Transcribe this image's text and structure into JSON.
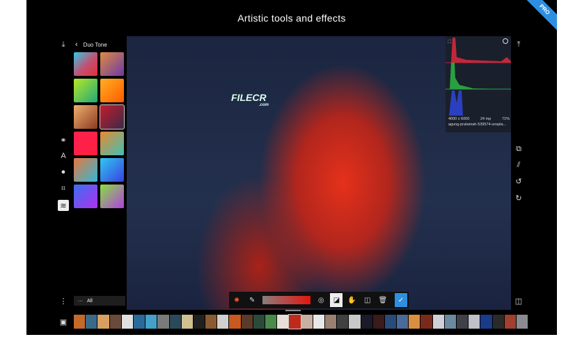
{
  "title": "Artistic tools and effects",
  "badge": "PRO",
  "panel": {
    "back_icon": "chevron-left",
    "title": "Duo Tone",
    "presets": [
      "linear-gradient(135deg,#33c7e8,#c35070 55%,#e0303a)",
      "linear-gradient(135deg,#e08a40,#6a3aa8)",
      "linear-gradient(135deg,#b8e828,#20a878)",
      "linear-gradient(135deg,#ffb020,#ff5a00)",
      "linear-gradient(135deg,#f0b070,#8a3a20)",
      "linear-gradient(135deg,#c41c2c,#3a2a48)",
      "linear-gradient(135deg,#ff2050,#ff2040)",
      "linear-gradient(135deg,#e88a30,#40c0b8)",
      "linear-gradient(135deg,#e87840,#30b8d8)",
      "linear-gradient(135deg,#30c8f0,#3a40e0)",
      "linear-gradient(135deg,#3a70f0,#b030f0)",
      "linear-gradient(135deg,#88e040,#b040e0)"
    ]
  },
  "filter_label": "All",
  "watermark": {
    "text": "FILECR",
    "sub": ".com"
  },
  "histogram": {
    "dimensions": "4000 x 6000",
    "megapixels": "24 mp",
    "zoom": "71%",
    "filename": "agung-pratamah-539574-unspla..."
  },
  "left_tools": [
    "download-icon",
    "blend-icon",
    "text-icon",
    "mask-icon",
    "crop-icon",
    "layers-icon",
    "more-icon"
  ],
  "right_tools": [
    "share-icon",
    "compare-icon",
    "hatch-icon",
    "history-icon",
    "undo-icon",
    "split-icon"
  ],
  "colors": {
    "accent": "#2e8fe0"
  },
  "filmstrip": [
    "#c36a2a",
    "#3a6a8a",
    "#d8a060",
    "#6a4a3a",
    "#e0e0e0",
    "#2a6a9a",
    "#44a0c8",
    "#7a7a7a",
    "#2a4a5a",
    "#d0c090",
    "#202020",
    "#8a5a30",
    "#d0d0d0",
    "#c85a20",
    "#5a3a2a",
    "#2a4a3a",
    "#4a8a4a",
    "#e8e0d8",
    "#c02a1a",
    "#c8b0a0",
    "#e8e8e8",
    "#9a8070",
    "#404040",
    "#c8c8c8",
    "#1a1a2a",
    "#3a1a1a",
    "#2a4a7a",
    "#4a6a9a",
    "#d89040",
    "#7a2a1a",
    "#d0d0d8",
    "#6a8aa0",
    "#404048",
    "#c0c0c8",
    "#1a3a8a",
    "#2a2a2a",
    "#a04030",
    "#8a8a90"
  ]
}
